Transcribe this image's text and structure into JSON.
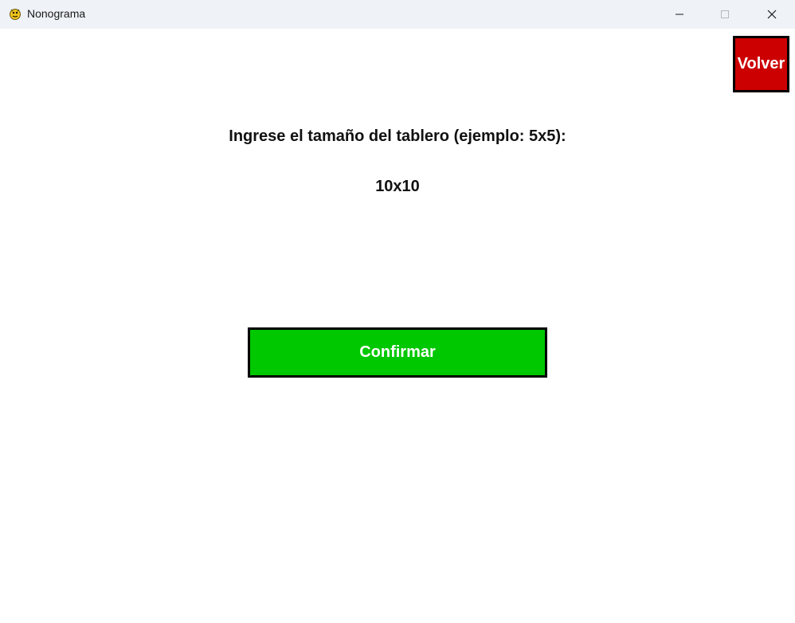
{
  "window": {
    "title": "Nonograma",
    "icon": "pygame-snake-icon"
  },
  "controls": {
    "minimize_icon": "minimize-icon",
    "maximize_icon": "maximize-icon",
    "close_icon": "close-icon"
  },
  "main": {
    "back_label": "Volver",
    "prompt": "Ingrese el tamaño del tablero (ejemplo: 5x5):",
    "input_value": "10x10",
    "confirm_label": "Confirmar"
  },
  "colors": {
    "back_button": "#cc0000",
    "confirm_button": "#00c800",
    "titlebar": "#eff2f7"
  }
}
